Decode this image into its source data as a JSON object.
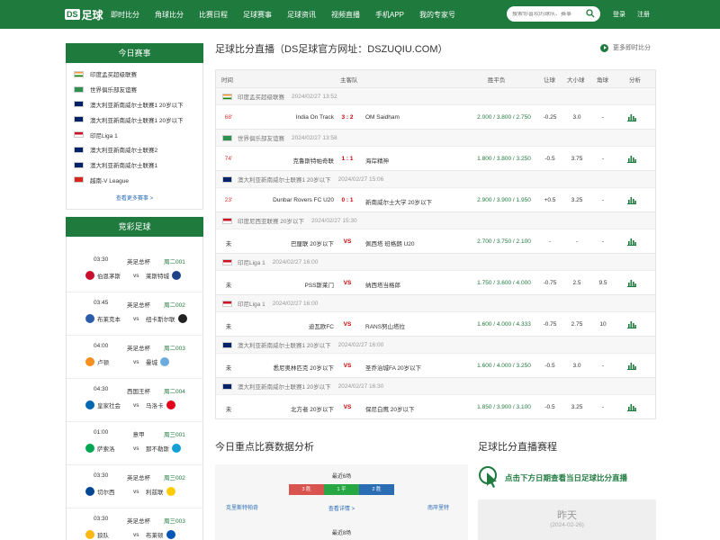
{
  "header": {
    "logo_prefix": "DS",
    "logo_text": "足球",
    "nav": [
      "即时比分",
      "角球比分",
      "比赛日程",
      "足球赛事",
      "足球资讯",
      "视频直播",
      "手机APP",
      "我的专家号"
    ],
    "search_placeholder": "搜索你喜欢的球队、赛事",
    "login": "登录",
    "register": "注册"
  },
  "sidebar": {
    "today_title": "今日赛事",
    "leagues": [
      {
        "name": "印度孟买超级联赛",
        "flag": "india"
      },
      {
        "name": "世界俱乐部友谊赛",
        "flag": "world"
      },
      {
        "name": "澳大利亚新南威尔士联赛1 20岁以下",
        "flag": "aus"
      },
      {
        "name": "澳大利亚新南威尔士联赛1 20岁以下",
        "flag": "aus"
      },
      {
        "name": "印尼Liga 1",
        "flag": "indo"
      },
      {
        "name": "澳大利亚新南威尔士联赛2",
        "flag": "aus"
      },
      {
        "name": "澳大利亚新南威尔士联赛1",
        "flag": "aus"
      },
      {
        "name": "越南-V League",
        "flag": "vn"
      }
    ],
    "more": "查看更多赛事 >",
    "jc_title": "竞彩足球",
    "jc_matches": [
      {
        "time": "03:30",
        "league": "英足总杯",
        "num": "周二001",
        "home": "伯恩茅斯",
        "vs": "vs",
        "away": "莱斯特城"
      },
      {
        "time": "03:45",
        "league": "英足总杯",
        "num": "周二002",
        "home": "布莱克本",
        "vs": "vs",
        "away": "纽卡斯尔联"
      },
      {
        "time": "04:00",
        "league": "英足总杯",
        "num": "周二003",
        "home": "卢顿",
        "vs": "vs",
        "away": "曼城"
      },
      {
        "time": "04:30",
        "league": "西国王杯",
        "num": "周二004",
        "home": "皇家社会",
        "vs": "vs",
        "away": "马洛卡"
      },
      {
        "time": "01:00",
        "league": "意甲",
        "num": "周三001",
        "home": "萨索洛",
        "vs": "vs",
        "away": "那不勒斯"
      },
      {
        "time": "03:30",
        "league": "英足总杯",
        "num": "周三002",
        "home": "切尔西",
        "vs": "vs",
        "away": "利兹联"
      },
      {
        "time": "03:30",
        "league": "英足总杯",
        "num": "周三003",
        "home": "狼队",
        "vs": "vs",
        "away": "布莱顿"
      }
    ]
  },
  "main": {
    "title": "足球比分直播（DS足球官方网址：DSZUQIU.COM）",
    "more": "更多即时比分",
    "headers": [
      "时间",
      "主客队",
      "胜平负",
      "让球",
      "大小球",
      "角球",
      "分析"
    ],
    "groups": [
      {
        "league": "印度孟买超级联赛",
        "date": "2024/02/27 13:52",
        "flag": "india",
        "match": {
          "time": "68'",
          "home": "India On Track",
          "score": "3 : 2",
          "away": "OM Saidham",
          "odds": "2.000 / 3.800 / 2.750",
          "hc": "-0.25",
          "ou": "3.0",
          "corner": "-"
        }
      },
      {
        "league": "世界俱乐部友谊赛",
        "date": "2024/02/27 13:58",
        "flag": "world",
        "match": {
          "time": "74'",
          "home": "克鲁斯特帕奇联",
          "score": "1 : 1",
          "away": "海岸精神",
          "odds": "1.800 / 3.800 / 3.250",
          "hc": "-0.5",
          "ou": "3.75",
          "corner": "-"
        }
      },
      {
        "league": "澳大利亚新南威尔士联赛1 20岁以下",
        "date": "2024/02/27 15:06",
        "flag": "aus",
        "match": {
          "time": "23'",
          "home": "Dunbar Rovers FC U20",
          "score": "0 : 1",
          "away": "新南威尔士大学 20岁以下",
          "odds": "2.900 / 3.900 / 1.950",
          "hc": "+0.5",
          "ou": "3.25",
          "corner": "-"
        }
      },
      {
        "league": "印度尼西亚联赛 20岁以下",
        "date": "2024/02/27 15:30",
        "flag": "indo",
        "match": {
          "time": "未",
          "home": "巴厘联 20岁以下",
          "score": "VS",
          "away": "佩西塔 班格朗 U20",
          "odds": "2.700 / 3.750 / 2.100",
          "hc": "-",
          "ou": "-",
          "corner": "-"
        }
      },
      {
        "league": "印尼Liga 1",
        "date": "2024/02/27 16:00",
        "flag": "indo",
        "match": {
          "time": "未",
          "home": "PSS斯莱门",
          "score": "VS",
          "away": "纳西塔当格郎",
          "odds": "1.750 / 3.600 / 4.000",
          "hc": "-0.75",
          "ou": "2.5",
          "corner": "9.5"
        }
      },
      {
        "league": "印尼Liga 1",
        "date": "2024/02/27 16:00",
        "flag": "indo",
        "match": {
          "time": "未",
          "home": "迪瓦欧FC",
          "score": "VS",
          "away": "RANS努山塔拉",
          "odds": "1.600 / 4.000 / 4.333",
          "hc": "-0.75",
          "ou": "2.75",
          "corner": "10"
        }
      },
      {
        "league": "澳大利亚新南威尔士联赛1 20岁以下",
        "date": "2024/02/27 16:00",
        "flag": "aus",
        "match": {
          "time": "未",
          "home": "悉尼奥林匹克 20岁以下",
          "score": "VS",
          "away": "圣乔治城FA 20岁以下",
          "odds": "1.600 / 4.000 / 3.250",
          "hc": "-0.5",
          "ou": "3.0",
          "corner": "-"
        }
      },
      {
        "league": "澳大利亚新南威尔士联赛1 20岁以下",
        "date": "2024/02/27 16:30",
        "flag": "aus",
        "match": {
          "time": "未",
          "home": "北方者 20岁以下",
          "score": "VS",
          "away": "保尼白鹰 20岁以下",
          "odds": "1.850 / 3.900 / 3.100",
          "hc": "-0.5",
          "ou": "3.25",
          "corner": "-"
        }
      }
    ]
  },
  "analysis": {
    "title": "今日重点比赛数据分析",
    "recent": "最近6场",
    "win": "3 胜",
    "draw": "1 平",
    "lose": "2 胜",
    "home": "克里斯特帕奇",
    "details": "查看详情 >",
    "away": "南岸里特",
    "recent2": "最近8场"
  },
  "schedule": {
    "title": "足球比分直播赛程",
    "cta": "点击下方日期查看当日足球比分直播",
    "yesterday": "昨天",
    "yesterday_date": "(2024-02-26)"
  },
  "colors": {
    "brand": "#1f7a3e",
    "win": "#d9534f",
    "draw": "#28a745",
    "lose": "#2a6db5"
  }
}
